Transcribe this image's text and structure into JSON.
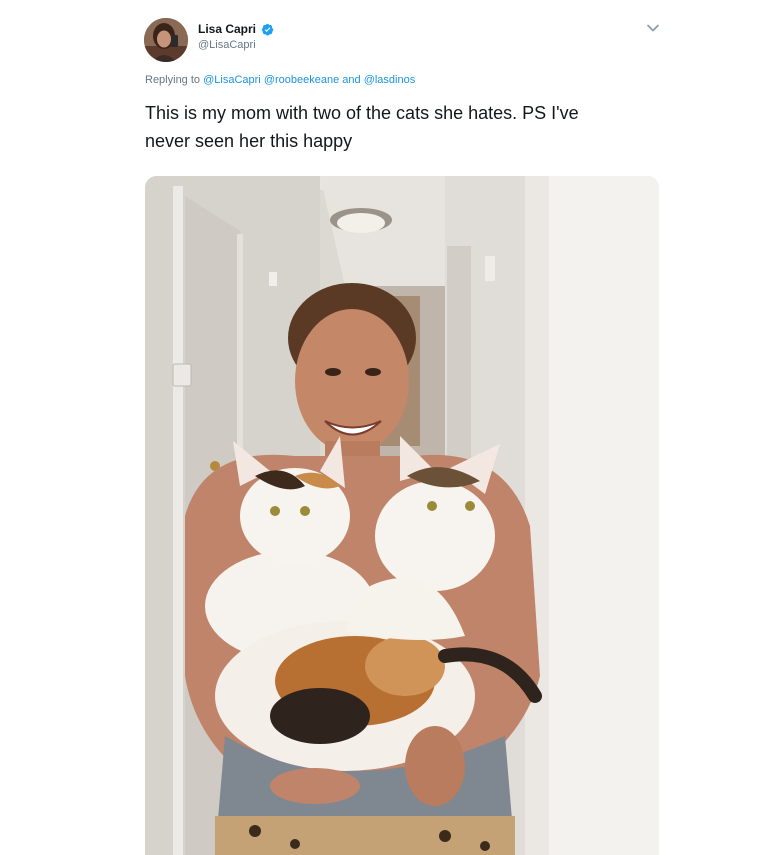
{
  "tweet": {
    "author": {
      "display_name": "Lisa Capri",
      "handle": "@LisaCapri",
      "verified_icon": "verified-badge-icon",
      "avatar": "profile-photo"
    },
    "menu_icon": "chevron-down-icon",
    "reply": {
      "prefix": "Replying to",
      "mention_1": "@LisaCapri",
      "mention_2": "@roobeekeane",
      "joiner": "and",
      "mention_3": "@lasdinos"
    },
    "text_line_1": "This is my mom with two of the cats she hates. PS I've",
    "text_line_2": "never seen her this happy",
    "media": {
      "type": "photo",
      "subject": "smiling woman holding two calico kittens in a hallway"
    }
  },
  "colors": {
    "link": "#1b95e0",
    "secondary_text": "#657786",
    "primary_text": "#14171a",
    "verified": "#1da1f2"
  }
}
